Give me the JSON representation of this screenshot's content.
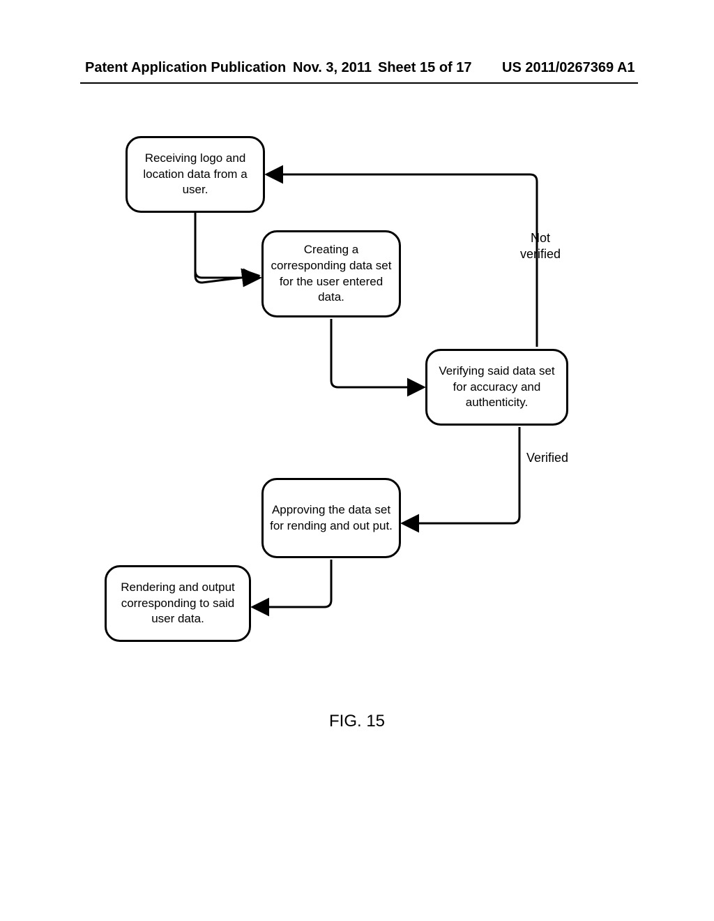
{
  "header": {
    "left": "Patent Application Publication",
    "date": "Nov. 3, 2011",
    "sheet": "Sheet 15 of 17",
    "pubno": "US 2011/0267369 A1"
  },
  "boxes": {
    "b1": "Receiving logo and location data from a user.",
    "b2": "Creating a corresponding data set for the user entered data.",
    "b3": "Verifying said data set for accuracy and authenticity.",
    "b4": "Approving the data set for rending and out put.",
    "b5": "Rendering and output corresponding to said user data."
  },
  "labels": {
    "notverified": "Not\nverified",
    "verified": "Verified"
  },
  "figure": "FIG. 15"
}
